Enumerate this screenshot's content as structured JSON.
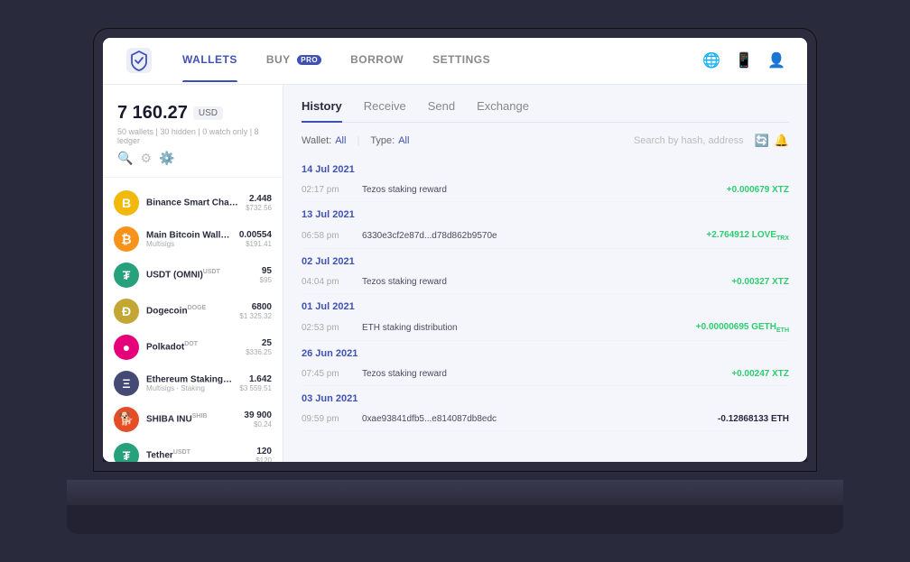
{
  "nav": {
    "items": [
      {
        "label": "WALLETS",
        "active": true
      },
      {
        "label": "BUY",
        "active": false,
        "badge": "PRO"
      },
      {
        "label": "BORROW",
        "active": false
      },
      {
        "label": "SETTINGS",
        "active": false
      }
    ]
  },
  "sidebar": {
    "total_balance": "7 160.27",
    "currency": "USD",
    "meta": "50 wallets | 30 hidden | 0 watch only | 8 ledger",
    "wallets": [
      {
        "name": "Binance Smart Chain...",
        "ticker": "",
        "icon_color": "#f0b90b",
        "icon_text": "B",
        "qty": "2.448",
        "usd": "$732.56",
        "sub": ""
      },
      {
        "name": "Main Bitcoin Wallet",
        "ticker": "BTC",
        "icon_color": "#f7931a",
        "icon_text": "₿",
        "qty": "0.00554",
        "usd": "$191.41",
        "sub": "Multisigs"
      },
      {
        "name": "USDT (OMNI)",
        "ticker": "USDT",
        "icon_color": "#26a17b",
        "icon_text": "₮",
        "qty": "95",
        "usd": "$95",
        "sub": ""
      },
      {
        "name": "Dogecoin",
        "ticker": "DOGE",
        "icon_color": "#c3a634",
        "icon_text": "Ð",
        "qty": "6800",
        "usd": "$1 325.32",
        "sub": ""
      },
      {
        "name": "Polkadot",
        "ticker": "DOT",
        "icon_color": "#e6007a",
        "icon_text": "●",
        "qty": "25",
        "usd": "$336.25",
        "sub": ""
      },
      {
        "name": "Ethereum Staking",
        "ticker": "ETH",
        "icon_color": "#454a75",
        "icon_text": "Ξ",
        "qty": "1.642",
        "usd": "$3 559.51",
        "sub": "Multisigs · Staking"
      },
      {
        "name": "SHIBA INU",
        "ticker": "SHIB",
        "icon_color": "#e44d26",
        "icon_text": "🐕",
        "qty": "39 900",
        "usd": "$0.24",
        "sub": ""
      },
      {
        "name": "Tether",
        "ticker": "USDT",
        "icon_color": "#26a17b",
        "icon_text": "₮",
        "qty": "120",
        "usd": "$120",
        "sub": ""
      }
    ]
  },
  "main": {
    "tabs": [
      {
        "label": "History",
        "active": true
      },
      {
        "label": "Receive",
        "active": false
      },
      {
        "label": "Send",
        "active": false
      },
      {
        "label": "Exchange",
        "active": false
      }
    ],
    "filters": {
      "wallet_label": "Wallet:",
      "wallet_value": "All",
      "type_label": "Type:",
      "type_value": "All",
      "search_placeholder": "Search by hash, address"
    },
    "history": [
      {
        "date": "14 Jul 2021",
        "entries": [
          {
            "time": "02:17 pm",
            "desc": "Tezos staking reward",
            "amount": "+0.000679 XTZ",
            "positive": true
          }
        ]
      },
      {
        "date": "13 Jul 2021",
        "entries": [
          {
            "time": "06:58 pm",
            "desc": "6330e3cf2e87d...d78d862b9570e",
            "amount": "+2.764912 LOVE",
            "positive": true,
            "amount_suffix": "TRX"
          }
        ]
      },
      {
        "date": "02 Jul 2021",
        "entries": [
          {
            "time": "04:04 pm",
            "desc": "Tezos staking reward",
            "amount": "+0.00327 XTZ",
            "positive": true
          }
        ]
      },
      {
        "date": "01 Jul 2021",
        "entries": [
          {
            "time": "02:53 pm",
            "desc": "ETH staking distribution",
            "amount": "+0.00000695 GETH",
            "positive": true,
            "amount_suffix": "ETH"
          }
        ]
      },
      {
        "date": "26 Jun 2021",
        "entries": [
          {
            "time": "07:45 pm",
            "desc": "Tezos staking reward",
            "amount": "+0.00247 XTZ",
            "positive": true
          }
        ]
      },
      {
        "date": "03 Jun 2021",
        "entries": [
          {
            "time": "09:59 pm",
            "desc": "0xae93841dfb5...e814087db8edc",
            "amount": "-0.12868133 ETH",
            "positive": false
          }
        ]
      }
    ]
  }
}
